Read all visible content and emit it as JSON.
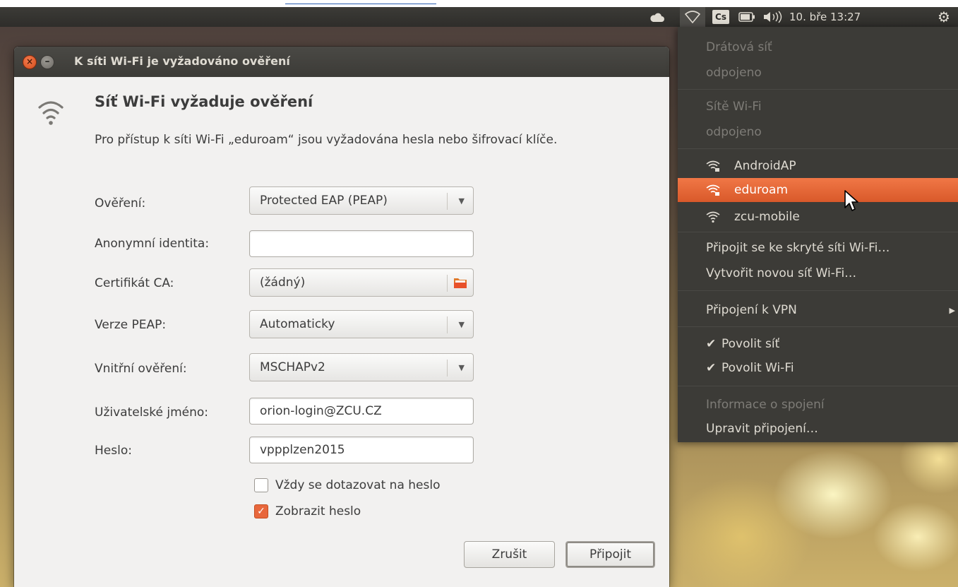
{
  "panel": {
    "wifi_icon": "wifi-outline-icon",
    "keyboard_layout": "Cs",
    "clock": "10. bře 13:27"
  },
  "dialog": {
    "title": "K síti Wi-Fi je vyžadováno ověření",
    "heading": "Síť Wi-Fi vyžaduje ověření",
    "description": "Pro přístup k síti Wi-Fi „eduroam“ jsou vyžadována hesla nebo šifrovací klíče.",
    "fields": {
      "auth_label": "Ověření:",
      "auth_value": "Protected EAP (PEAP)",
      "anon_label": "Anonymní identita:",
      "anon_value": "",
      "ca_label": "Certifikát CA:",
      "ca_value": "(žádný)",
      "peap_label": "Verze PEAP:",
      "peap_value": "Automaticky",
      "inner_label": "Vnitřní ověření:",
      "inner_value": "MSCHAPv2",
      "user_label": "Uživatelské jméno:",
      "user_value": "orion-login@ZCU.CZ",
      "pass_label": "Heslo:",
      "pass_value": "vppplzen2015"
    },
    "always_ask_label": "Vždy se dotazovat na heslo",
    "always_ask_checked": false,
    "show_password_label": "Zobrazit heslo",
    "show_password_checked": true,
    "cancel_label": "Zrušit",
    "connect_label": "Připojit"
  },
  "network_menu": {
    "wired_header": "Drátová síť",
    "wired_status": "odpojeno",
    "wifi_header": "Sítě Wi-Fi",
    "wifi_status": "odpojeno",
    "networks": [
      {
        "name": "AndroidAP",
        "secured": true,
        "selected": false
      },
      {
        "name": "eduroam",
        "secured": true,
        "selected": true
      },
      {
        "name": "zcu-mobile",
        "secured": false,
        "selected": false
      }
    ],
    "hidden_network": "Připojit se ke skryté síti Wi-Fi…",
    "new_network": "Vytvořit novou síť Wi-Fi…",
    "vpn": "Připojení k VPN",
    "enable_network": "Povolit síť",
    "enable_wifi": "Povolit Wi-Fi",
    "connection_info": "Informace o spojení",
    "edit_connections": "Upravit připojení…"
  },
  "colors": {
    "accent": "#e8673c",
    "menu_bg": "#3c3b37",
    "dialog_bg": "#f2f1f0"
  }
}
